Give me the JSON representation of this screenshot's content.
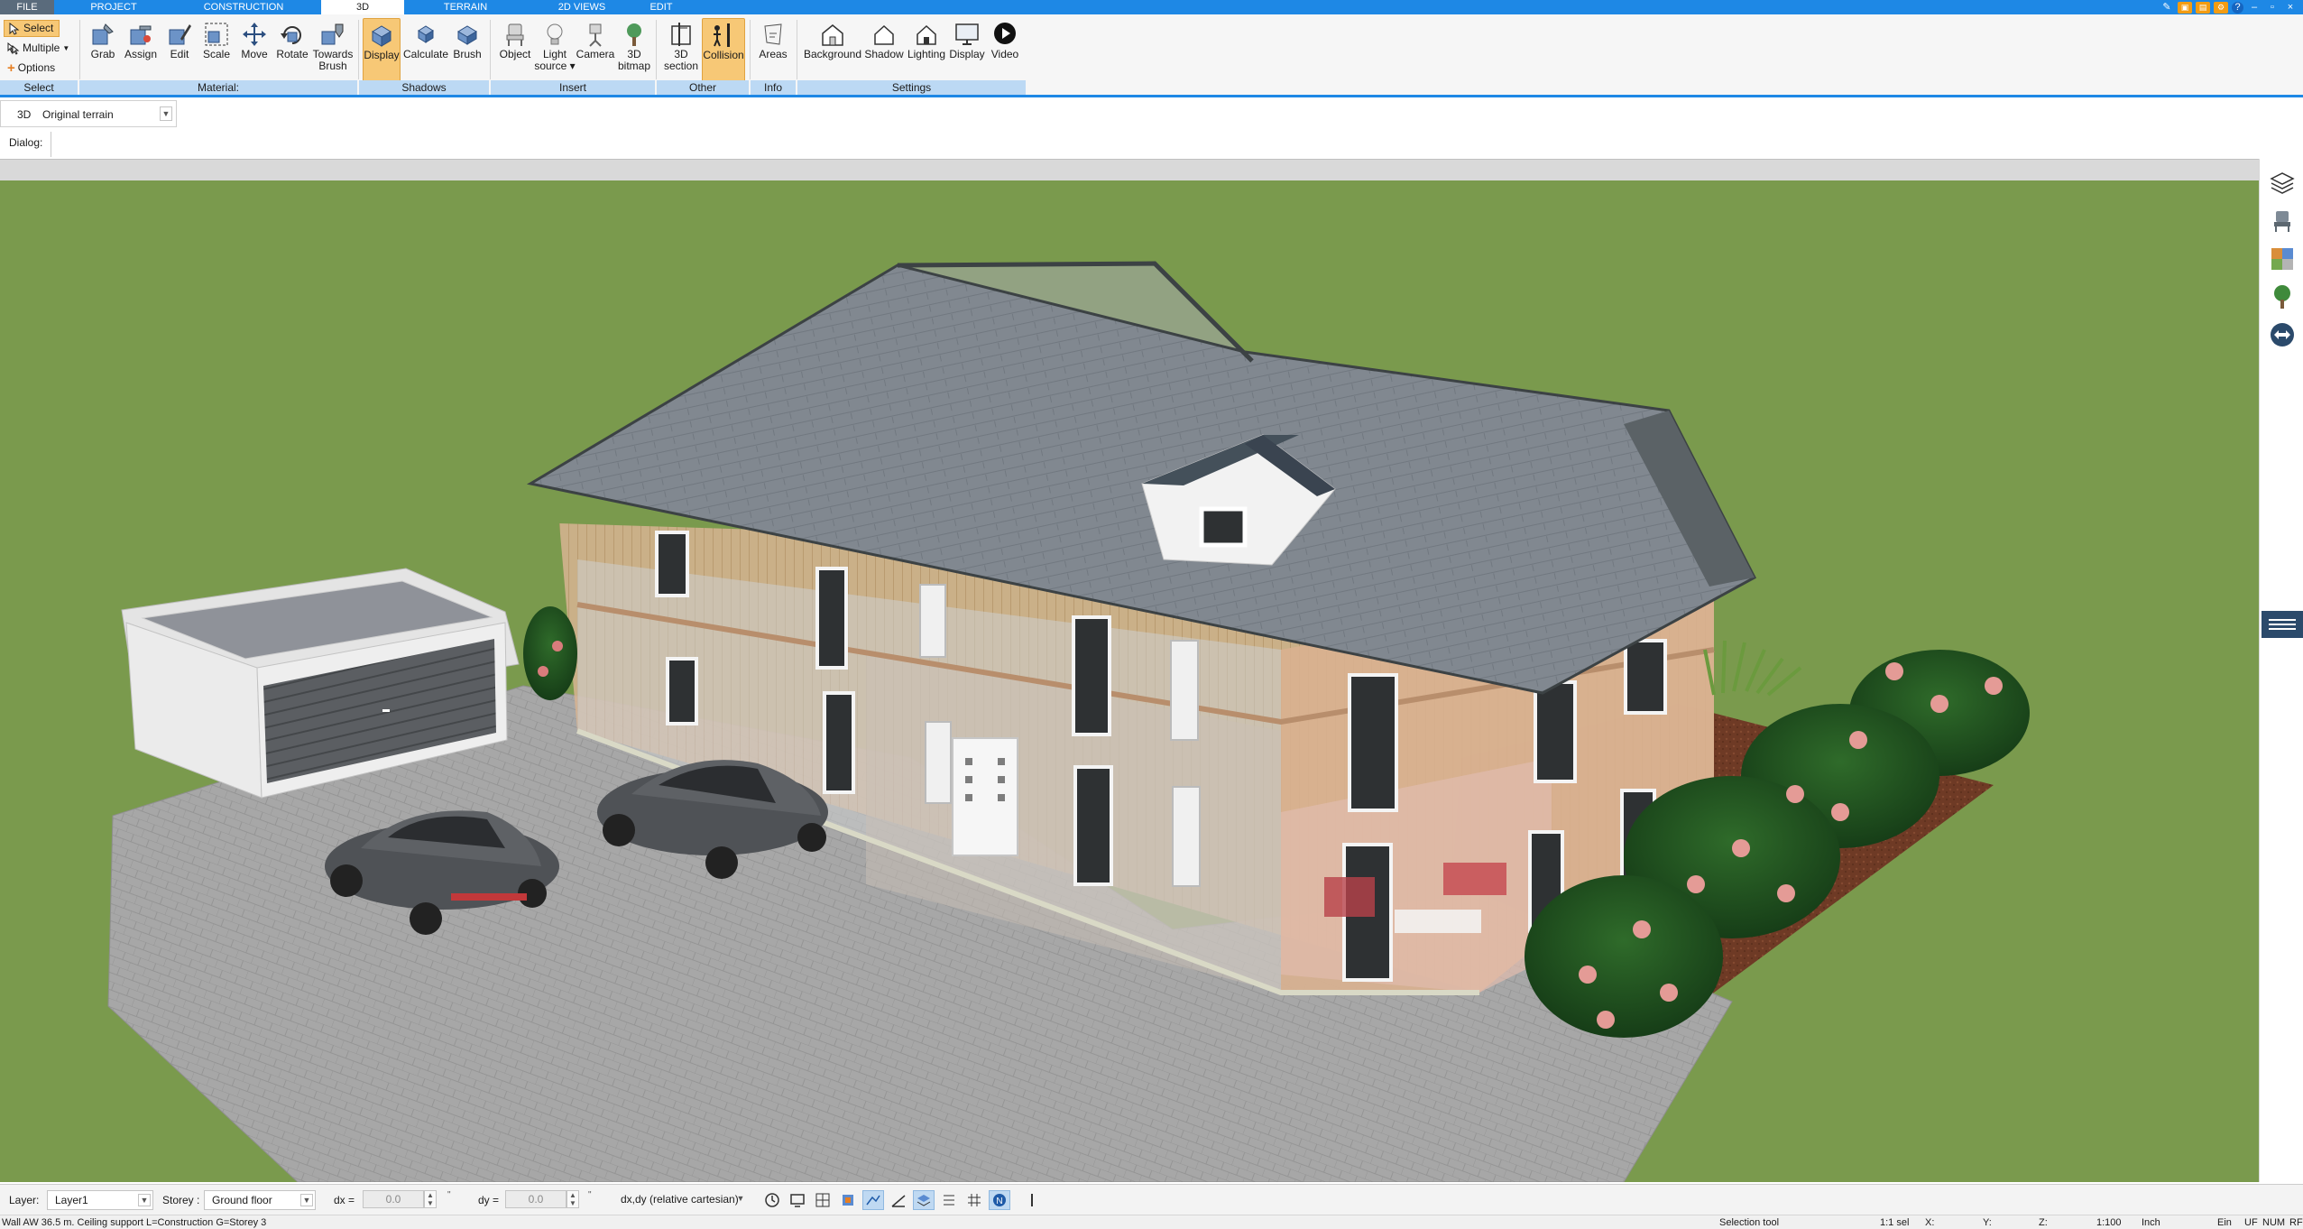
{
  "menu": {
    "tabs": [
      {
        "label": "FILE"
      },
      {
        "label": "PROJECT"
      },
      {
        "label": "CONSTRUCTION"
      },
      {
        "label": "3D"
      },
      {
        "label": "TERRAIN"
      },
      {
        "label": "2D VIEWS"
      },
      {
        "label": "EDIT"
      }
    ],
    "active_tab": "3D",
    "colors": {
      "bar": "#1e88e5",
      "file_tab": "#5a6b7c"
    }
  },
  "ribbon": {
    "select_group": {
      "select_label": "Select",
      "multiple_label": "Multiple",
      "options_label": "Options",
      "group_label": "Select"
    },
    "material_group": {
      "buttons": [
        {
          "label": "Grab",
          "icon": "grab-material-icon"
        },
        {
          "label": "Assign",
          "icon": "assign-material-icon"
        },
        {
          "label": "Edit",
          "icon": "edit-material-icon"
        },
        {
          "label": "Scale",
          "icon": "scale-icon"
        },
        {
          "label": "Move",
          "icon": "move-icon"
        },
        {
          "label": "Rotate",
          "icon": "rotate-icon"
        },
        {
          "label": "Towards",
          "label2": "Brush",
          "icon": "towards-brush-icon"
        }
      ],
      "group_label": "Material:"
    },
    "shadows_group": {
      "buttons": [
        {
          "label": "Display",
          "icon": "display-shadows-icon",
          "active": true
        },
        {
          "label": "Calculate",
          "icon": "calculate-shadows-icon"
        },
        {
          "label": "Brush",
          "icon": "shadow-brush-icon"
        }
      ],
      "group_label": "Shadows"
    },
    "insert_group": {
      "buttons": [
        {
          "label": "Object",
          "icon": "object-chair-icon"
        },
        {
          "label": "Light",
          "label2": "source ▾",
          "icon": "light-bulb-icon"
        },
        {
          "label": "Camera",
          "icon": "camera-icon"
        },
        {
          "label": "3D",
          "label2": "bitmap",
          "icon": "tree-bitmap-icon"
        }
      ],
      "group_label": "Insert"
    },
    "other_group": {
      "buttons": [
        {
          "label": "3D",
          "label2": "section",
          "icon": "section-icon"
        },
        {
          "label": "Collision",
          "icon": "collision-icon",
          "active": true
        }
      ],
      "group_label": "Other"
    },
    "info_group": {
      "buttons": [
        {
          "label": "Areas",
          "icon": "areas-icon"
        }
      ],
      "group_label": "Info"
    },
    "settings_group": {
      "buttons": [
        {
          "label": "Background",
          "icon": "background-icon"
        },
        {
          "label": "Shadow",
          "icon": "shadow-house-icon"
        },
        {
          "label": "Lighting",
          "icon": "lighting-house-icon"
        },
        {
          "label": "Display",
          "icon": "display-monitor-icon"
        },
        {
          "label": "Video",
          "icon": "video-play-icon"
        }
      ],
      "group_label": "Settings"
    }
  },
  "view_select": {
    "tag": "3D",
    "value": "Original terrain"
  },
  "dialog": {
    "label": "Dialog:"
  },
  "viewport": {
    "colors": {
      "grass": "#7a9a4d",
      "roof": "#7d8489",
      "driveway": "#a3a3a3",
      "mulch": "#6e3a25"
    }
  },
  "sidebar": {
    "icons": [
      "layers-icon",
      "furniture-chair-icon",
      "materials-palette-icon",
      "plants-tree-icon",
      "navigation-arrows-icon"
    ]
  },
  "bottom": {
    "layer_label": "Layer:",
    "layer_value": "Layer1",
    "storey_label": "Storey :",
    "storey_value": "Ground floor",
    "dx_label": "dx =",
    "dx_value": "0.0",
    "dy_label": "dy =",
    "dy_value": "0.0",
    "mode_value": "dx,dy (relative cartesian)"
  },
  "status": {
    "message": "Wall AW 36.5 m. Ceiling support L=Construction G=Storey 3",
    "tool": "Selection tool",
    "selection": "1:1 sel",
    "x_label": "X:",
    "y_label": "Y:",
    "z_label": "Z:",
    "scale": "1:100",
    "unit": "Inch",
    "ein": "Ein",
    "uf": "UF",
    "num": "NUM",
    "rf": "RF"
  }
}
